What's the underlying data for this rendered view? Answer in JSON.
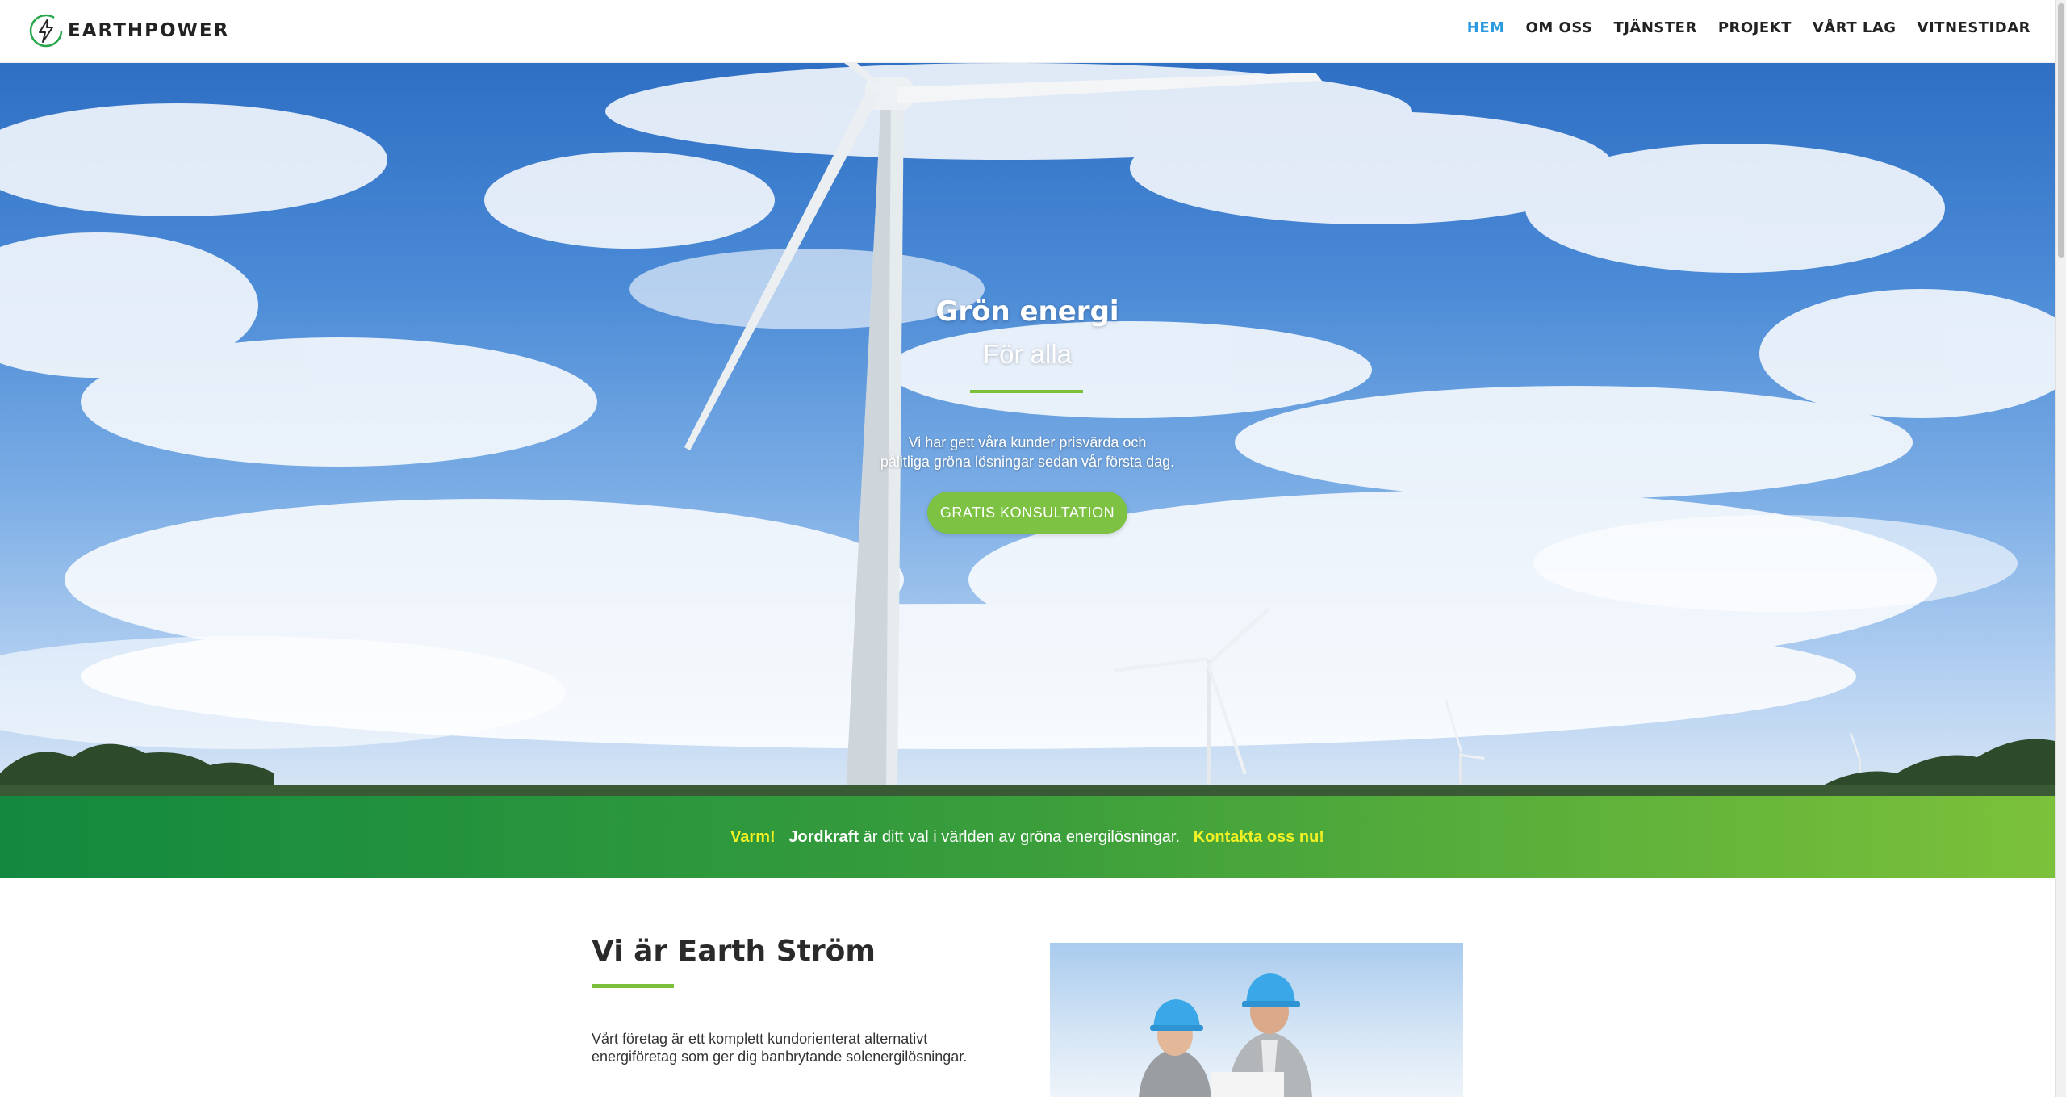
{
  "header": {
    "logo_text": "EARTHPOWER",
    "nav": [
      {
        "label": "HEM",
        "active": true
      },
      {
        "label": "OM OSS"
      },
      {
        "label": "TJÄNSTER"
      },
      {
        "label": "PROJEKT"
      },
      {
        "label": "VÅRT LAG"
      },
      {
        "label": "VITNESTIDAR"
      }
    ]
  },
  "hero": {
    "title": "Grön energi",
    "subtitle": "För alla",
    "text_line1": "Vi har gett våra kunder prisvärda och",
    "text_line2": "pålitliga gröna lösningar sedan vår första dag.",
    "button_label": "GRATIS KONSULTATION"
  },
  "banner": {
    "part1": "Varm!",
    "part2": "Jordkraft",
    "part3": " är ditt val i världen av gröna energilösningar.",
    "part4": "Kontakta oss nu!"
  },
  "about": {
    "title": "Vi är Earth Ström",
    "text": "Vårt företag är ett komplett kundorienterat alternativt energiföretag som ger dig banbrytande solenergilösningar."
  },
  "colors": {
    "accent_green": "#7cbf3a",
    "nav_active": "#2b9ae0",
    "banner_highlight": "#f3f125"
  }
}
